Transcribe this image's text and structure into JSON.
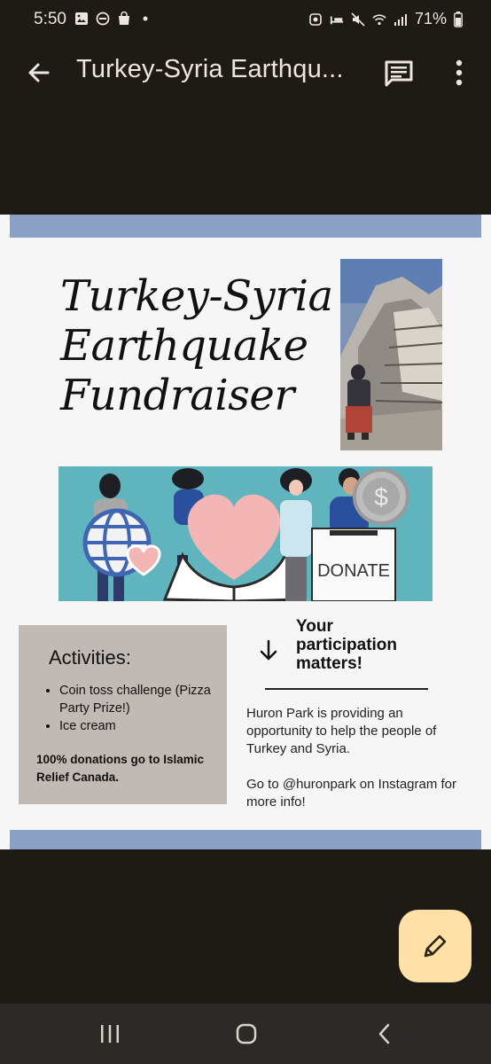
{
  "status_bar": {
    "time": "5:50",
    "battery_percent": "71%",
    "left_icons": [
      "gallery-icon",
      "do-not-disturb-icon",
      "shopping-bag-icon",
      "dot-icon"
    ],
    "right_icons": [
      "recycle-icon",
      "sleep-icon",
      "mute-icon",
      "wifi-icon",
      "signal-icon",
      "battery-icon"
    ]
  },
  "app_bar": {
    "title": "Turkey-Syria Earthqu...",
    "icons": [
      "back-arrow-icon",
      "comment-icon",
      "more-vert-icon"
    ]
  },
  "flyer": {
    "title_lines": [
      "Turkey-Syria",
      "Earthquake",
      "Fundraiser"
    ],
    "banner_label": "DONATE",
    "activities": {
      "heading": "Activities:",
      "items": [
        "Coin toss challenge (Pizza Party Prize!)",
        "Ice cream"
      ],
      "footer": "100% donations go to Islamic Relief Canada."
    },
    "participation": "Your participation matters!",
    "info_paragraphs": [
      "Huron Park is providing an opportunity to help the people of Turkey and Syria.",
      "Go to @huronpark on Instagram for more info!"
    ],
    "colors": {
      "stripe": "#8ba0c5",
      "activities_bg": "#c1b9b3",
      "banner_bg": "#5fb4be"
    }
  },
  "fab": {
    "icon": "pencil-icon",
    "color": "#ffe0a6"
  },
  "nav_bar": {
    "icons": [
      "recents-icon",
      "home-icon",
      "back-icon"
    ]
  }
}
